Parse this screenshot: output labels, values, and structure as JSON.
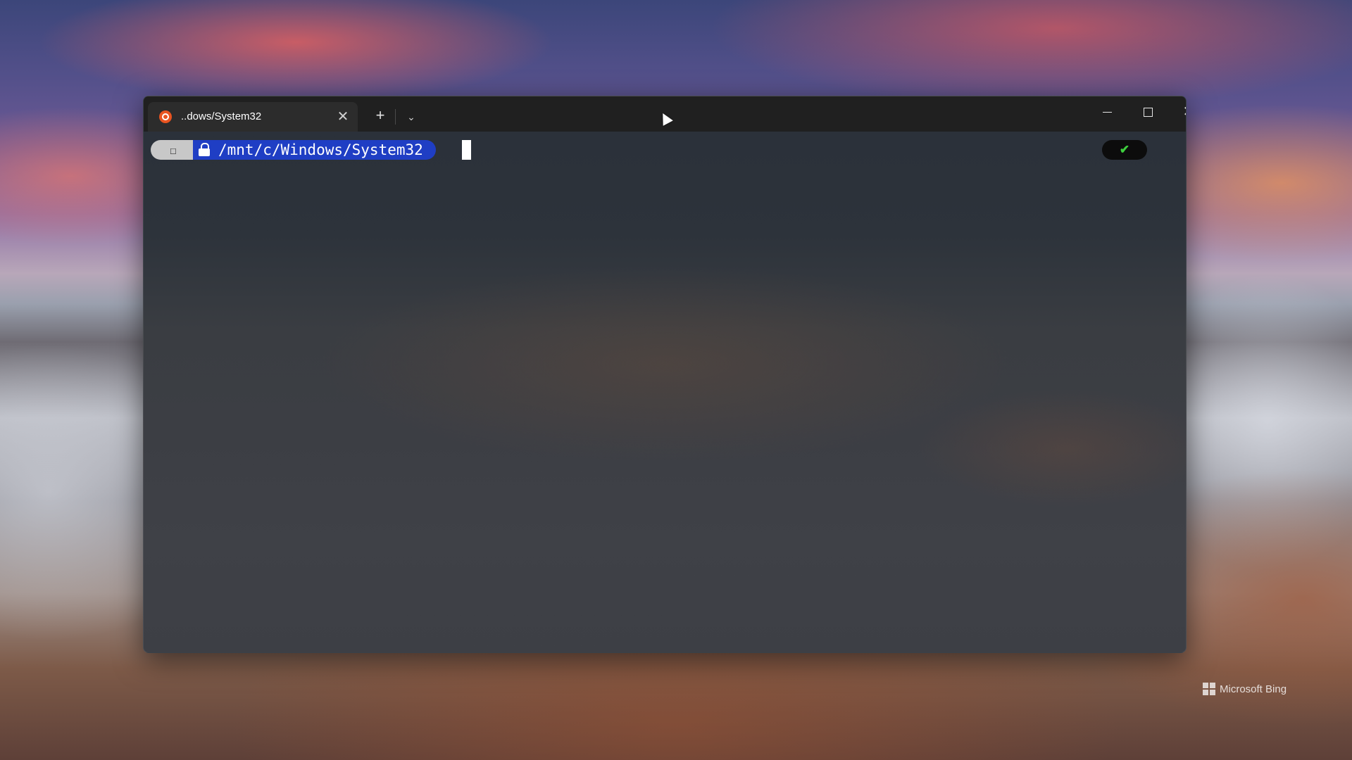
{
  "window": {
    "tab": {
      "title": "..dows/System32",
      "icon": "ubuntu-icon",
      "close_label": "✕"
    },
    "new_tab_label": "+",
    "dropdown_label": "⌄",
    "controls": {
      "close_label": "✕"
    }
  },
  "terminal": {
    "prompt": {
      "os_icon": "☐",
      "path": "/mnt/c/Windows/System32"
    },
    "status": "✔"
  },
  "desktop": {
    "watermark": "Microsoft Bing"
  },
  "colors": {
    "prompt_path_bg": "#1f3ec4",
    "prompt_os_bg": "#c8c8c8",
    "status_ok": "#3ecf3e",
    "titlebar_bg": "#202020"
  }
}
